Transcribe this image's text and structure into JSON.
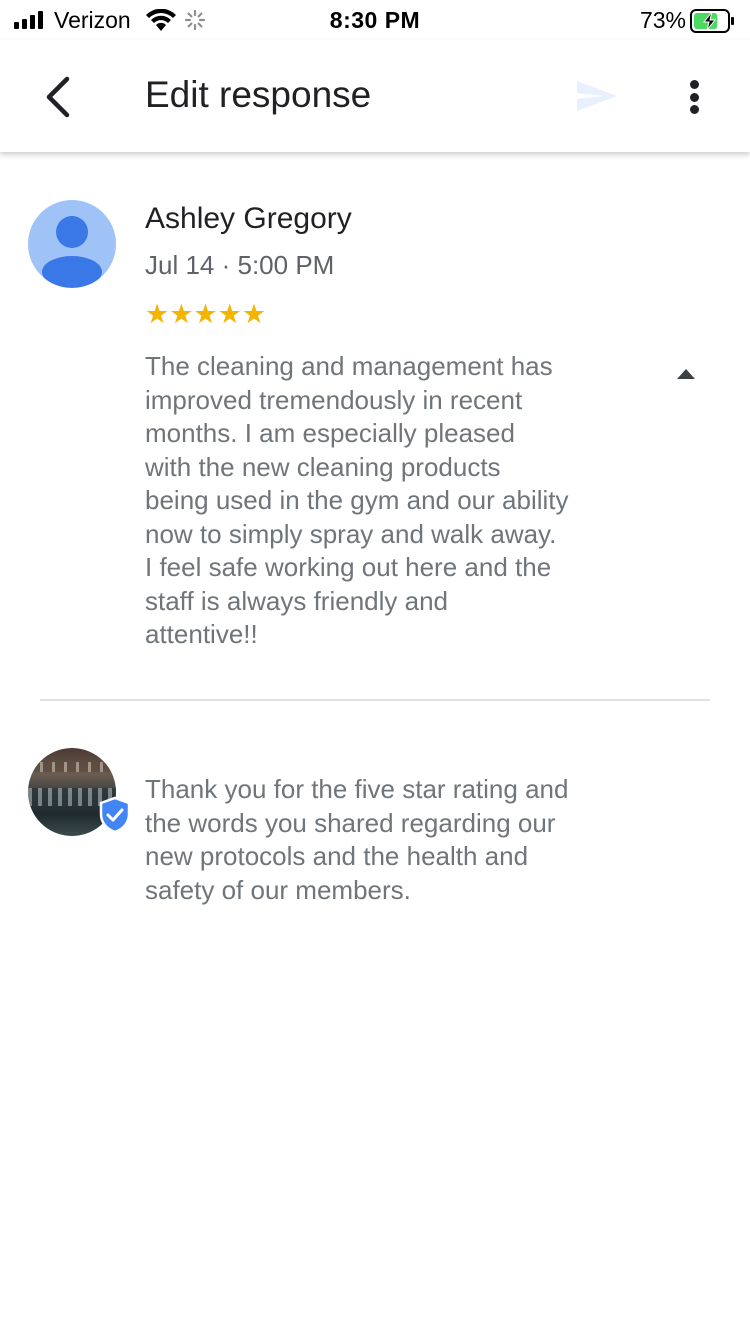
{
  "status_bar": {
    "carrier": "Verizon",
    "time": "8:30 PM",
    "battery_percent": "73%",
    "battery_level": 0.73
  },
  "app_bar": {
    "title": "Edit response",
    "back_icon": "chevron-left-icon",
    "send_icon": "send-icon",
    "more_icon": "more-vert-icon"
  },
  "review": {
    "reviewer_name": "Ashley Gregory",
    "date": "Jul 14 · 5:00 PM",
    "rating": 5,
    "stars": "★★★★★",
    "text": "The cleaning and management has\nimproved tremendously in recent\nmonths.  I am especially pleased\nwith the new cleaning products\nbeing used in the gym and our ability\nnow to simply spray and walk away.\nI feel safe working out here and the\nstaff is always friendly and\nattentive!!"
  },
  "response": {
    "text": "Thank you for the five star rating and\nthe words you shared regarding our\nnew protocols and the health and\nsafety of our members."
  },
  "colors": {
    "star": "#f4b400",
    "avatar_bg": "#9fc3f7",
    "avatar_fg": "#3b78e7",
    "verified": "#4285f4",
    "send_disabled": "#e8f0fe",
    "battery_fill": "#4cd964"
  }
}
